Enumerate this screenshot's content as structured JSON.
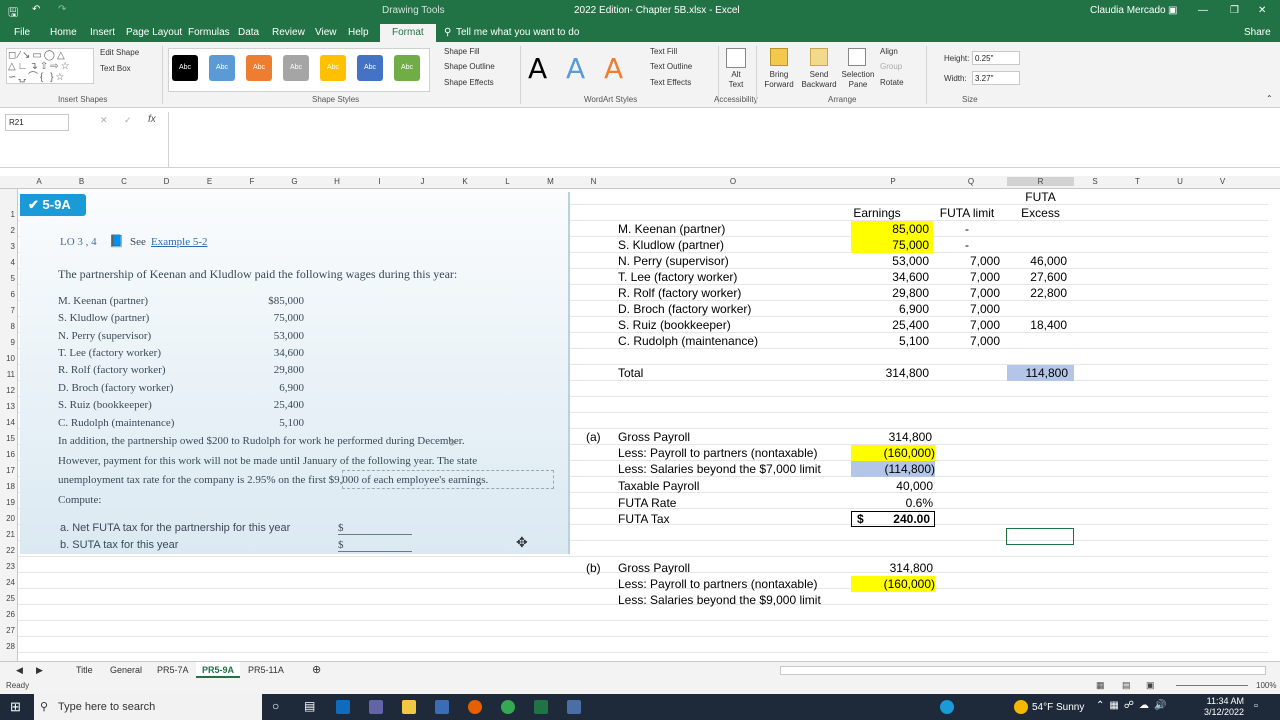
{
  "titlebar": {
    "tools": "Drawing Tools",
    "title": "2022 Edition- Chapter 5B.xlsx - Excel",
    "user": "Claudia Mercado"
  },
  "tabs": [
    "File",
    "Home",
    "Insert",
    "Page Layout",
    "Formulas",
    "Data",
    "Review",
    "View",
    "Help",
    "Format"
  ],
  "tell_me": "Tell me what you want to do",
  "share": "Share",
  "ribbon": {
    "insert_shapes": {
      "label": "Insert Shapes",
      "edit_shape": "Edit Shape",
      "text_box": "Text Box"
    },
    "shape_styles": {
      "label": "Shape Styles",
      "sample": "Abc",
      "fill": "Shape Fill",
      "outline": "Shape Outline",
      "effects": "Shape Effects"
    },
    "wordart": {
      "label": "WordArt Styles",
      "letter": "A",
      "text_fill": "Text Fill",
      "text_outline": "Text Outline",
      "text_effects": "Text Effects"
    },
    "accessibility": {
      "label": "Accessibility",
      "alt_text": "Alt Text"
    },
    "arrange": {
      "label": "Arrange",
      "bring_forward": "Bring Forward",
      "send_backward": "Send Backward",
      "selection_pane": "Selection Pane",
      "align": "Align",
      "group": "Group",
      "rotate": "Rotate"
    },
    "size": {
      "label": "Size",
      "height_label": "Height:",
      "height": "0.25\"",
      "width_label": "Width:",
      "width": "3.27\""
    }
  },
  "namebox": "R21",
  "fx": "fx",
  "columns": [
    "A",
    "B",
    "C",
    "D",
    "E",
    "F",
    "G",
    "H",
    "I",
    "J",
    "K",
    "L",
    "M",
    "N",
    "O",
    "P",
    "Q",
    "R",
    "S",
    "T",
    "U",
    "V"
  ],
  "rows": [
    "1",
    "2",
    "3",
    "4",
    "5",
    "6",
    "7",
    "8",
    "9",
    "10",
    "11",
    "12",
    "13",
    "14",
    "15",
    "16",
    "17",
    "18",
    "19",
    "20",
    "21",
    "22",
    "23",
    "24",
    "25",
    "26",
    "27",
    "28"
  ],
  "panel": {
    "badge": "5-9A",
    "lo": "LO 3 , 4",
    "see": "See",
    "example": "Example 5-2",
    "intro": "The partnership of Keenan and Kludlow paid the following wages during this year:",
    "wages": [
      {
        "name": "M. Keenan (partner)",
        "amt": "$85,000"
      },
      {
        "name": "S. Kludlow (partner)",
        "amt": "75,000"
      },
      {
        "name": "N. Perry (supervisor)",
        "amt": "53,000"
      },
      {
        "name": "T. Lee (factory worker)",
        "amt": "34,600"
      },
      {
        "name": "R. Rolf (factory worker)",
        "amt": "29,800"
      },
      {
        "name": "D. Broch (factory worker)",
        "amt": "6,900"
      },
      {
        "name": "S. Ruiz (bookkeeper)",
        "amt": "25,400"
      },
      {
        "name": "C. Rudolph (maintenance)",
        "amt": "5,100"
      }
    ],
    "para1": "In addition, the partnership owed $200 to Rudolph for work he performed during December.",
    "para2": "However, payment for this work will not be made until January of the following year. The state",
    "para3": "unemployment tax rate for the company is 2.95% on the first $9,000 of each employee's earnings.",
    "compute": "Compute:",
    "qa": "a.  Net FUTA tax for the partnership for this year",
    "qb": "b.  SUTA tax for this year",
    "dollar": "$"
  },
  "sheet": {
    "hdr_earnings": "Earnings",
    "hdr_futa_limit": "FUTA limit",
    "hdr_futa": "FUTA",
    "hdr_excess": "Excess",
    "employees": [
      {
        "name": "M. Keenan (partner)",
        "earn": "85,000",
        "limit": "-",
        "excess": ""
      },
      {
        "name": "S. Kludlow (partner)",
        "earn": "75,000",
        "limit": "-",
        "excess": ""
      },
      {
        "name": "N. Perry (supervisor)",
        "earn": "53,000",
        "limit": "7,000",
        "excess": "46,000"
      },
      {
        "name": "T. Lee (factory worker)",
        "earn": "34,600",
        "limit": "7,000",
        "excess": "27,600"
      },
      {
        "name": "R. Rolf (factory worker)",
        "earn": "29,800",
        "limit": "7,000",
        "excess": "22,800"
      },
      {
        "name": "D. Broch (factory worker)",
        "earn": "6,900",
        "limit": "7,000",
        "excess": ""
      },
      {
        "name": "S. Ruiz (bookkeeper)",
        "earn": "25,400",
        "limit": "7,000",
        "excess": "18,400"
      },
      {
        "name": "C. Rudolph (maintenance)",
        "earn": "5,100",
        "limit": "7,000",
        "excess": ""
      }
    ],
    "total_label": "Total",
    "total_earn": "314,800",
    "total_excess": "114,800",
    "a_label": "(a)",
    "a_rows": [
      {
        "label": "Gross Payroll",
        "val": "314,800"
      },
      {
        "label": "Less: Payroll to partners (nontaxable)",
        "val": "(160,000)"
      },
      {
        "label": "Less: Salaries beyond the $7,000 limit",
        "val": "(114,800)"
      },
      {
        "label": "Taxable Payroll",
        "val": "40,000"
      },
      {
        "label": "FUTA Rate",
        "val": "0.6%"
      },
      {
        "label": "FUTA Tax",
        "cur": "$",
        "val": "240.00"
      }
    ],
    "b_label": "(b)",
    "b_rows": [
      {
        "label": "Gross Payroll",
        "val": "314,800"
      },
      {
        "label": "Less: Payroll to partners (nontaxable)",
        "val": "(160,000)"
      },
      {
        "label": "Less: Salaries beyond the $9,000 limit",
        "val": ""
      }
    ]
  },
  "sheet_tabs": [
    "Title",
    "General",
    "PR5-7A",
    "PR5-9A",
    "PR5-11A"
  ],
  "active_tab": "PR5-9A",
  "status": {
    "ready": "Ready",
    "zoom": "100%"
  },
  "taskbar": {
    "search": "Type here to search",
    "weather": "54°F  Sunny",
    "time": "11:34 AM",
    "date": "3/12/2022"
  }
}
